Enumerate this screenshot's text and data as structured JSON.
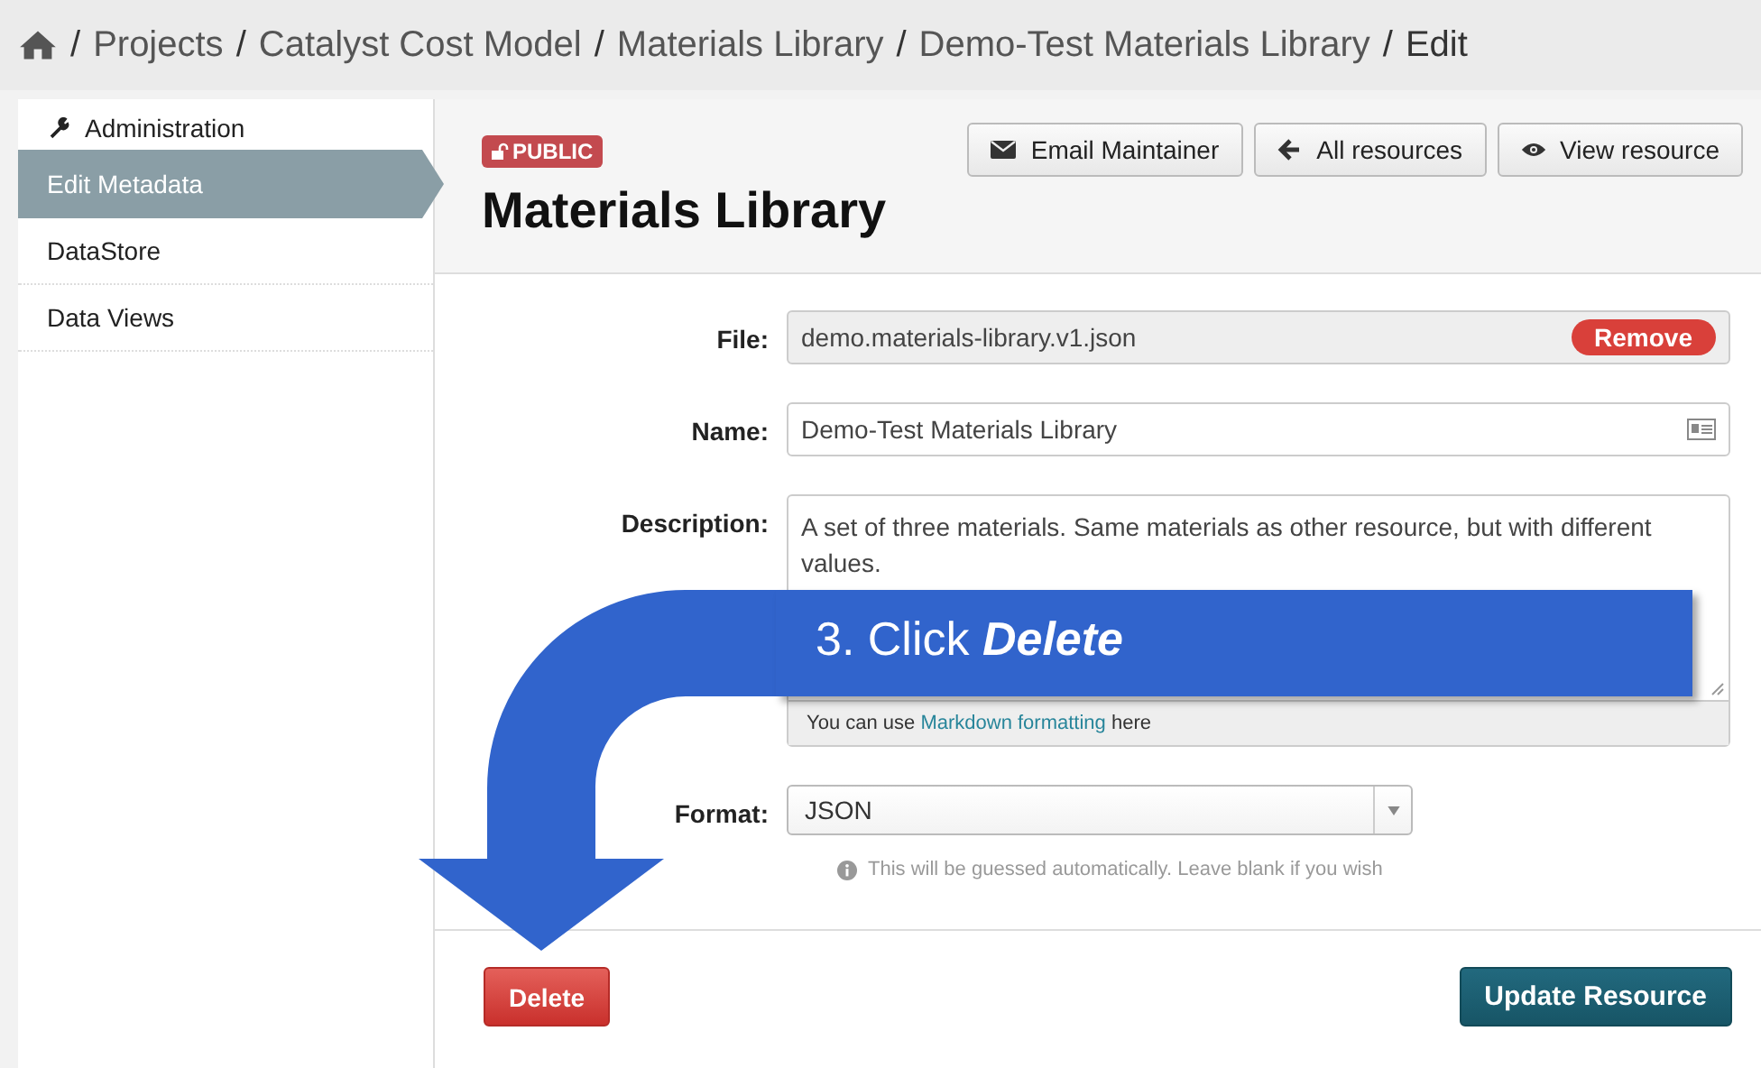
{
  "separator": "/",
  "breadcrumb": [
    "Projects",
    "Catalyst Cost Model",
    "Materials Library",
    "Demo-Test Materials Library",
    "Edit"
  ],
  "sidebar": {
    "heading": "Administration",
    "items": [
      {
        "label": "Edit Metadata",
        "selected": true
      },
      {
        "label": "DataStore",
        "selected": false
      },
      {
        "label": "Data Views",
        "selected": false
      }
    ]
  },
  "badge": "PUBLIC",
  "actions": [
    {
      "label": "Email Maintainer",
      "kind": "mail"
    },
    {
      "label": "All resources",
      "kind": "back"
    },
    {
      "label": "View resource",
      "kind": "eye"
    }
  ],
  "title": "Materials Library",
  "form": {
    "file": {
      "label": "File:",
      "value": "demo.materials-library.v1.json",
      "remove": "Remove"
    },
    "name": {
      "label": "Name:",
      "value": "Demo-Test Materials Library"
    },
    "description": {
      "label": "Description:",
      "value": "A set of three materials. Same materials as other resource, but with different values.",
      "hint_before": "You can use",
      "hint_link": "Markdown formatting",
      "hint_after": "here"
    },
    "format": {
      "label": "Format:",
      "value": "JSON",
      "hint": "This will be guessed automatically. Leave blank if you wish"
    }
  },
  "delete_button": "Delete",
  "update_button": "Update Resource",
  "callout": "3. Click **Delete**"
}
